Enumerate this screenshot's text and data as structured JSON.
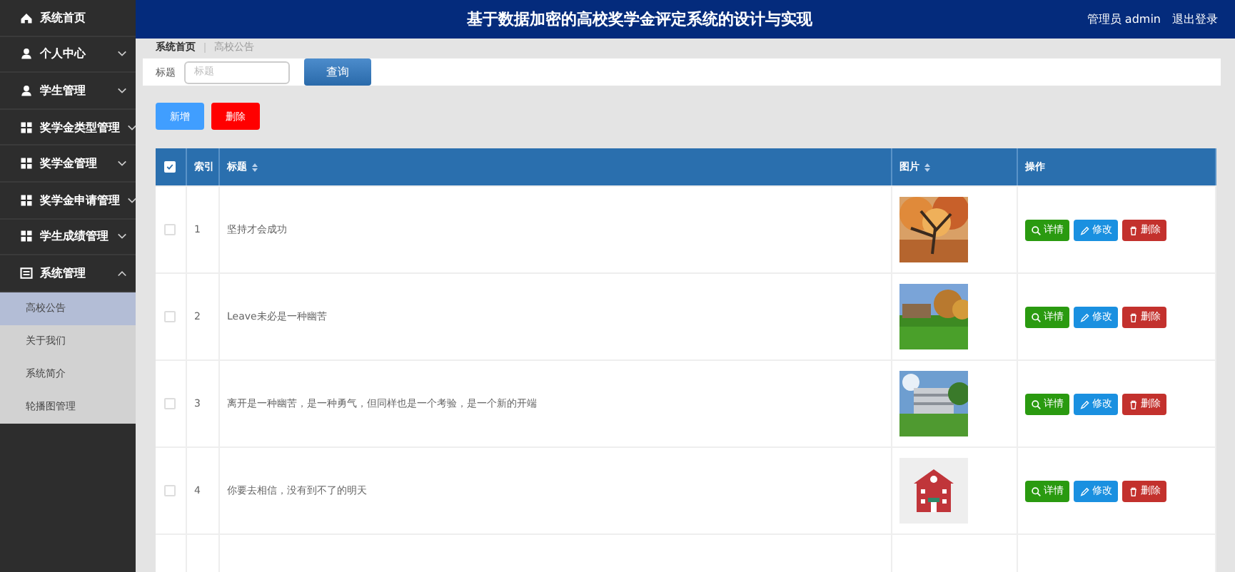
{
  "sidebar": {
    "items": [
      {
        "label": "系统首页",
        "kind": "home"
      },
      {
        "label": "个人中心",
        "kind": "user",
        "expanded": false
      },
      {
        "label": "学生管理",
        "kind": "user",
        "expanded": false
      },
      {
        "label": "奖学金类型管理",
        "kind": "module",
        "expanded": false
      },
      {
        "label": "奖学金管理",
        "kind": "module",
        "expanded": false
      },
      {
        "label": "奖学金申请管理",
        "kind": "module",
        "expanded": false
      },
      {
        "label": "学生成绩管理",
        "kind": "module",
        "expanded": false
      },
      {
        "label": "系统管理",
        "kind": "system",
        "expanded": true,
        "children": [
          {
            "label": "高校公告",
            "selected": true
          },
          {
            "label": "关于我们",
            "selected": false
          },
          {
            "label": "系统简介",
            "selected": false
          },
          {
            "label": "轮播图管理",
            "selected": false
          }
        ]
      }
    ]
  },
  "header": {
    "title": "基于数据加密的高校奖学金评定系统的设计与实现",
    "user": "管理员 admin",
    "logout": "退出登录"
  },
  "breadcrumb": [
    "系统首页",
    "高校公告"
  ],
  "search": {
    "label": "标题",
    "placeholder": "标题",
    "button": "查询"
  },
  "toolbar": [
    {
      "label": "新增",
      "kind": "add"
    },
    {
      "label": "删除",
      "kind": "delete"
    }
  ],
  "table": {
    "select_all": {
      "checked": true
    },
    "columns": [
      {
        "label": "索引",
        "sortable": false
      },
      {
        "label": "标题",
        "sortable": true
      },
      {
        "label": "图片",
        "sortable": true
      },
      {
        "label": "操作",
        "sortable": false
      }
    ],
    "rows": [
      {
        "checked": false,
        "index": "1",
        "title": "坚持才会成功",
        "actions": [
          {
            "label": "详情",
            "kind": "detail"
          },
          {
            "label": "修改",
            "kind": "edit"
          },
          {
            "label": "删除",
            "kind": "delete"
          }
        ]
      },
      {
        "checked": false,
        "index": "2",
        "title": "Leave未必是一种幽苦",
        "actions": [
          {
            "label": "详情",
            "kind": "detail"
          },
          {
            "label": "修改",
            "kind": "edit"
          },
          {
            "label": "删除",
            "kind": "delete"
          }
        ]
      },
      {
        "checked": false,
        "index": "3",
        "title": "离开是一种幽苦，是一种勇气，但同样也是一个考验，是一个新的开端",
        "actions": [
          {
            "label": "详情",
            "kind": "detail"
          },
          {
            "label": "修改",
            "kind": "edit"
          },
          {
            "label": "删除",
            "kind": "delete"
          }
        ]
      },
      {
        "checked": false,
        "index": "4",
        "title": "你要去相信，没有到不了的明天",
        "actions": [
          {
            "label": "详情",
            "kind": "detail"
          },
          {
            "label": "修改",
            "kind": "edit"
          },
          {
            "label": "删除",
            "kind": "delete"
          }
        ]
      }
    ]
  }
}
